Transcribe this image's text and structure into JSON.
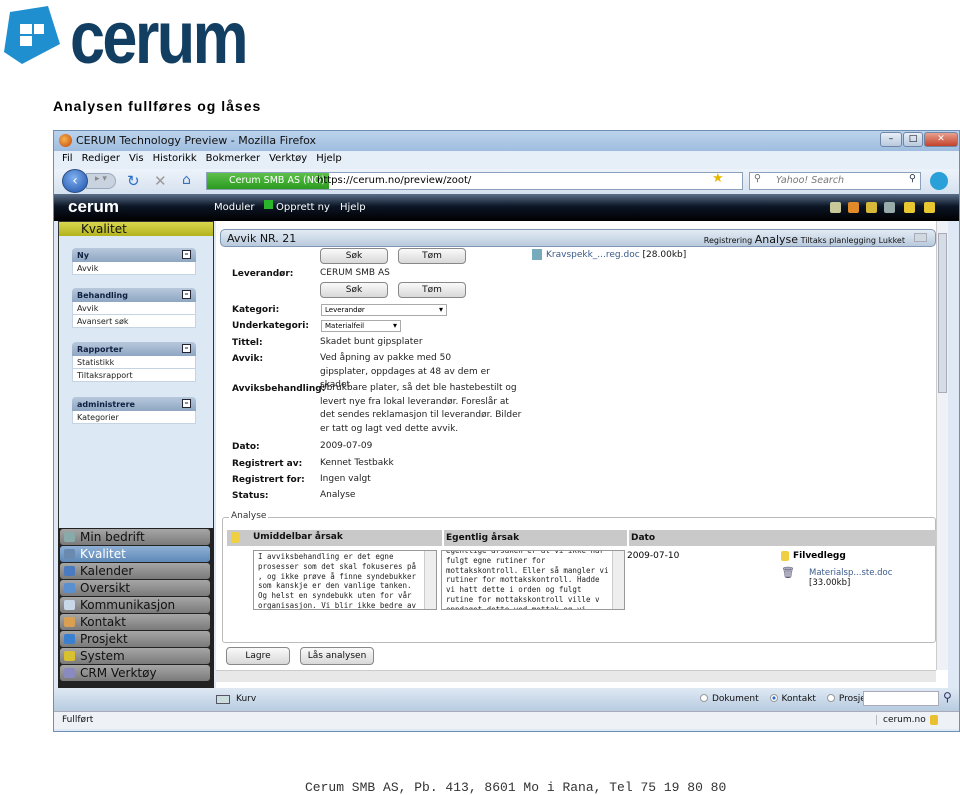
{
  "brand": {
    "logo_text": "cerum",
    "color": "#123e62",
    "accent": "#1f8fd0"
  },
  "heading": "Analysen fullføres og låses",
  "browser": {
    "title": "CERUM Technology Preview - Mozilla Firefox",
    "menu": [
      "Fil",
      "Rediger",
      "Vis",
      "Historikk",
      "Bokmerker",
      "Verktøy",
      "Hjelp"
    ],
    "identity": "Cerum SMB AS (NO)",
    "url": "https://cerum.no/preview/zoot/",
    "search_placeholder": "Yahoo! Search",
    "status": "Fullført",
    "status_domain": "cerum.no"
  },
  "app": {
    "logo": "cerum",
    "toolbar": [
      "Moduler",
      "Opprett ny",
      "Hjelp"
    ],
    "sidebar": {
      "header": "Kvalitet",
      "groups": [
        {
          "title": "Ny",
          "items": [
            "Avvik"
          ]
        },
        {
          "title": "Behandling",
          "items": [
            "Avvik",
            "Avansert søk"
          ]
        },
        {
          "title": "Rapporter",
          "items": [
            "Statistikk",
            "Tiltaksrapport"
          ]
        },
        {
          "title": "administrere",
          "items": [
            "Kategorier"
          ]
        }
      ],
      "modules": [
        "Min bedrift",
        "Kvalitet",
        "Kalender",
        "Oversikt",
        "Kommunikasjon",
        "Kontakt",
        "Prosjekt",
        "System",
        "CRM Verktøy"
      ],
      "active_module": "Kvalitet"
    },
    "panel": {
      "title": "Avvik NR. 21",
      "steps": [
        "Registrering",
        "Analyse",
        "Tiltaks planlegging",
        "Lukket"
      ],
      "current_step": "Analyse",
      "sok": "Søk",
      "tom": "Tøm",
      "attachment": "Kravspekk_...reg.doc",
      "attachment_size": "[28.00kb]",
      "fields": {
        "leverandor_label": "Leverandør:",
        "leverandor": "CERUM SMB AS",
        "kategori_label": "Kategori:",
        "kategori": "Leverandør",
        "underkategori_label": "Underkategori:",
        "underkategori": "Materialfeil",
        "tittel_label": "Tittel:",
        "tittel": "Skadet bunt gipsplater",
        "avvik_label": "Avvik:",
        "avvik": "Ved åpning av pakke med 50 gipsplater, oppdages at 48 av dem er skadet.",
        "behandling_label": "Avviksbehandling:",
        "behandling": "Ubrukbare plater, så det ble hastebestilt og levert nye fra lokal leverandør. Foreslår at det sendes reklamasjon til leverandør. Bilder er tatt og lagt ved dette avvik.",
        "dato_label": "Dato:",
        "dato": "2009-07-09",
        "regav_label": "Registrert av:",
        "regav": "Kennet Testbakk",
        "regfor_label": "Registrert for:",
        "regfor": "Ingen valgt",
        "status_label": "Status:",
        "status": "Analyse"
      },
      "analyse": {
        "legend": "Analyse",
        "headers": [
          "Umiddelbar årsak",
          "Egentlig årsak",
          "Dato"
        ],
        "umiddelbar": "I avviksbehandling er det egne prosesser som det skal fokuseres på , og ikke prøve å finne syndebukker som kanskje er den vanlige tanken.  Og helst en syndebukk uten for vår organisasjon. Vi blir ikke bedre av det!",
        "egentlig": "egentlige årsaken er at vi ikke har fulgt egne rutiner for mottakskontroll. Eller så mangler vi rutiner for mottakskontroll. Hadde vi hatt dette i orden og fulgt rutine for mottakskontroll ville v oppdaget dette ved mottak og vi kunne fått nye plater i god tid før de skulle benyttes i produksjon.",
        "dato": "2009-07-10",
        "filvedlegg": "Filvedlegg",
        "file": "Materialsp...ste.doc",
        "file_size": "[33.00kb]"
      },
      "lagre": "Lagre",
      "las": "Lås analysen"
    },
    "bottom": {
      "kurv": "Kurv",
      "radios": [
        "Dokument",
        "Kontakt",
        "Prosjekt"
      ],
      "selected": "Kontakt"
    }
  },
  "footer": "Cerum SMB AS, Pb. 413, 8601 Mo i Rana, Tel  75 19 80 80"
}
